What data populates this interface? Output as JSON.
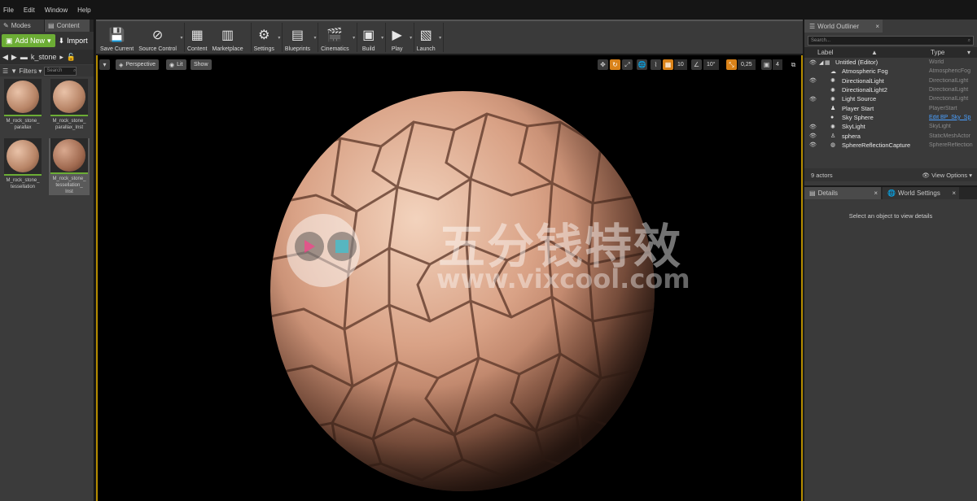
{
  "menu": [
    "File",
    "Edit",
    "Window",
    "Help"
  ],
  "left_panel": {
    "tabs": [
      "Modes",
      "Content"
    ],
    "add_new": "Add New",
    "import": "Import",
    "path": "k_stone",
    "filters": "Filters",
    "search_placeholder": "Search",
    "assets": [
      {
        "label_1": "M_rock_stone_",
        "label_2": "parallax",
        "label_3": ""
      },
      {
        "label_1": "M_rock_stone_",
        "label_2": "parallax_Inst",
        "label_3": ""
      },
      {
        "label_1": "M_rock_stone_",
        "label_2": "tessellation",
        "label_3": ""
      },
      {
        "label_1": "M_rock_stone_",
        "label_2": "tessellation_",
        "label_3": "Inst"
      }
    ]
  },
  "toolbar": {
    "items": [
      {
        "label": "Save Current",
        "icon": "floppy-icon"
      },
      {
        "label": "Source Control",
        "icon": "source-control-icon"
      },
      {
        "label": "Content",
        "icon": "content-icon"
      },
      {
        "label": "Marketplace",
        "icon": "marketplace-icon"
      },
      {
        "label": "Settings",
        "icon": "gear-icon"
      },
      {
        "label": "Blueprints",
        "icon": "blueprint-icon"
      },
      {
        "label": "Cinematics",
        "icon": "clapper-icon"
      },
      {
        "label": "Build",
        "icon": "build-icon"
      },
      {
        "label": "Play",
        "icon": "play-icon"
      },
      {
        "label": "Launch",
        "icon": "launch-icon"
      }
    ]
  },
  "viewport": {
    "perspective": "Perspective",
    "lit": "Lit",
    "show": "Show",
    "grid_snap": "10",
    "rot_snap": "10°",
    "scale_snap": "0,25",
    "camera_speed": "4",
    "watermark_text": "五分钱特效",
    "watermark_url": "www.vixcool.com"
  },
  "outliner": {
    "tab": "World Outliner",
    "search_placeholder": "Search...",
    "col_label": "Label",
    "col_type": "Type",
    "rows": [
      {
        "name": "Untitled (Editor)",
        "type": "World",
        "indent": 0,
        "visible": true
      },
      {
        "name": "Atmospheric Fog",
        "type": "AtmosphericFog",
        "indent": 1,
        "visible": false
      },
      {
        "name": "DirectionalLight",
        "type": "DirectionalLight",
        "indent": 1,
        "visible": true
      },
      {
        "name": "DirectionalLight2",
        "type": "DirectionalLight",
        "indent": 1,
        "visible": false
      },
      {
        "name": "Light Source",
        "type": "DirectionalLight",
        "indent": 1,
        "visible": true
      },
      {
        "name": "Player Start",
        "type": "PlayerStart",
        "indent": 1,
        "visible": false
      },
      {
        "name": "Sky Sphere",
        "type": "Edit BP_Sky_Sp",
        "indent": 1,
        "visible": false,
        "link": true
      },
      {
        "name": "SkyLight",
        "type": "SkyLight",
        "indent": 1,
        "visible": true
      },
      {
        "name": "sphera",
        "type": "StaticMeshActor",
        "indent": 1,
        "visible": true
      },
      {
        "name": "SphereReflectionCapture",
        "type": "SphereReflection",
        "indent": 1,
        "visible": true
      }
    ],
    "actor_count": "9 actors",
    "view_options": "View Options"
  },
  "details": {
    "tabs": [
      "Details",
      "World Settings"
    ],
    "empty_message": "Select an object to view details"
  },
  "colors": {
    "accent_green": "#6cad35",
    "viewport_border": "#b58c00",
    "link_blue": "#4aa0ff"
  }
}
